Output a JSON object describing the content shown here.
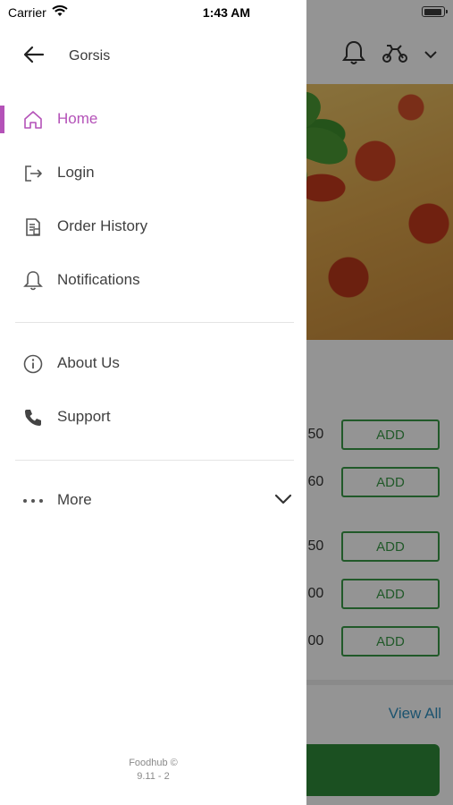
{
  "status_bar": {
    "carrier": "Carrier",
    "time": "1:43 AM"
  },
  "background": {
    "rows": [
      {
        "price": ".50",
        "add_label": "ADD"
      },
      {
        "price": ".60",
        "add_label": "ADD"
      },
      {
        "price": ".50",
        "add_label": "ADD"
      },
      {
        "price": ".00",
        "add_label": "ADD"
      },
      {
        "price": ".00",
        "add_label": "ADD"
      }
    ],
    "view_all": "View All"
  },
  "drawer": {
    "title": "Gorsis",
    "items": [
      {
        "label": "Home",
        "icon": "home-icon",
        "active": true
      },
      {
        "label": "Login",
        "icon": "login-icon"
      },
      {
        "label": "Order History",
        "icon": "receipt-icon"
      },
      {
        "label": "Notifications",
        "icon": "bell-icon"
      },
      {
        "label": "About Us",
        "icon": "info-icon"
      },
      {
        "label": "Support",
        "icon": "phone-icon"
      },
      {
        "label": "More",
        "icon": "more-icon"
      }
    ],
    "footer": {
      "brand": "Foodhub ©",
      "version": "9.11 - 2"
    }
  },
  "colors": {
    "accent": "#b452b8",
    "add_green": "#3a9a48",
    "link_blue": "#2f8fbf"
  }
}
